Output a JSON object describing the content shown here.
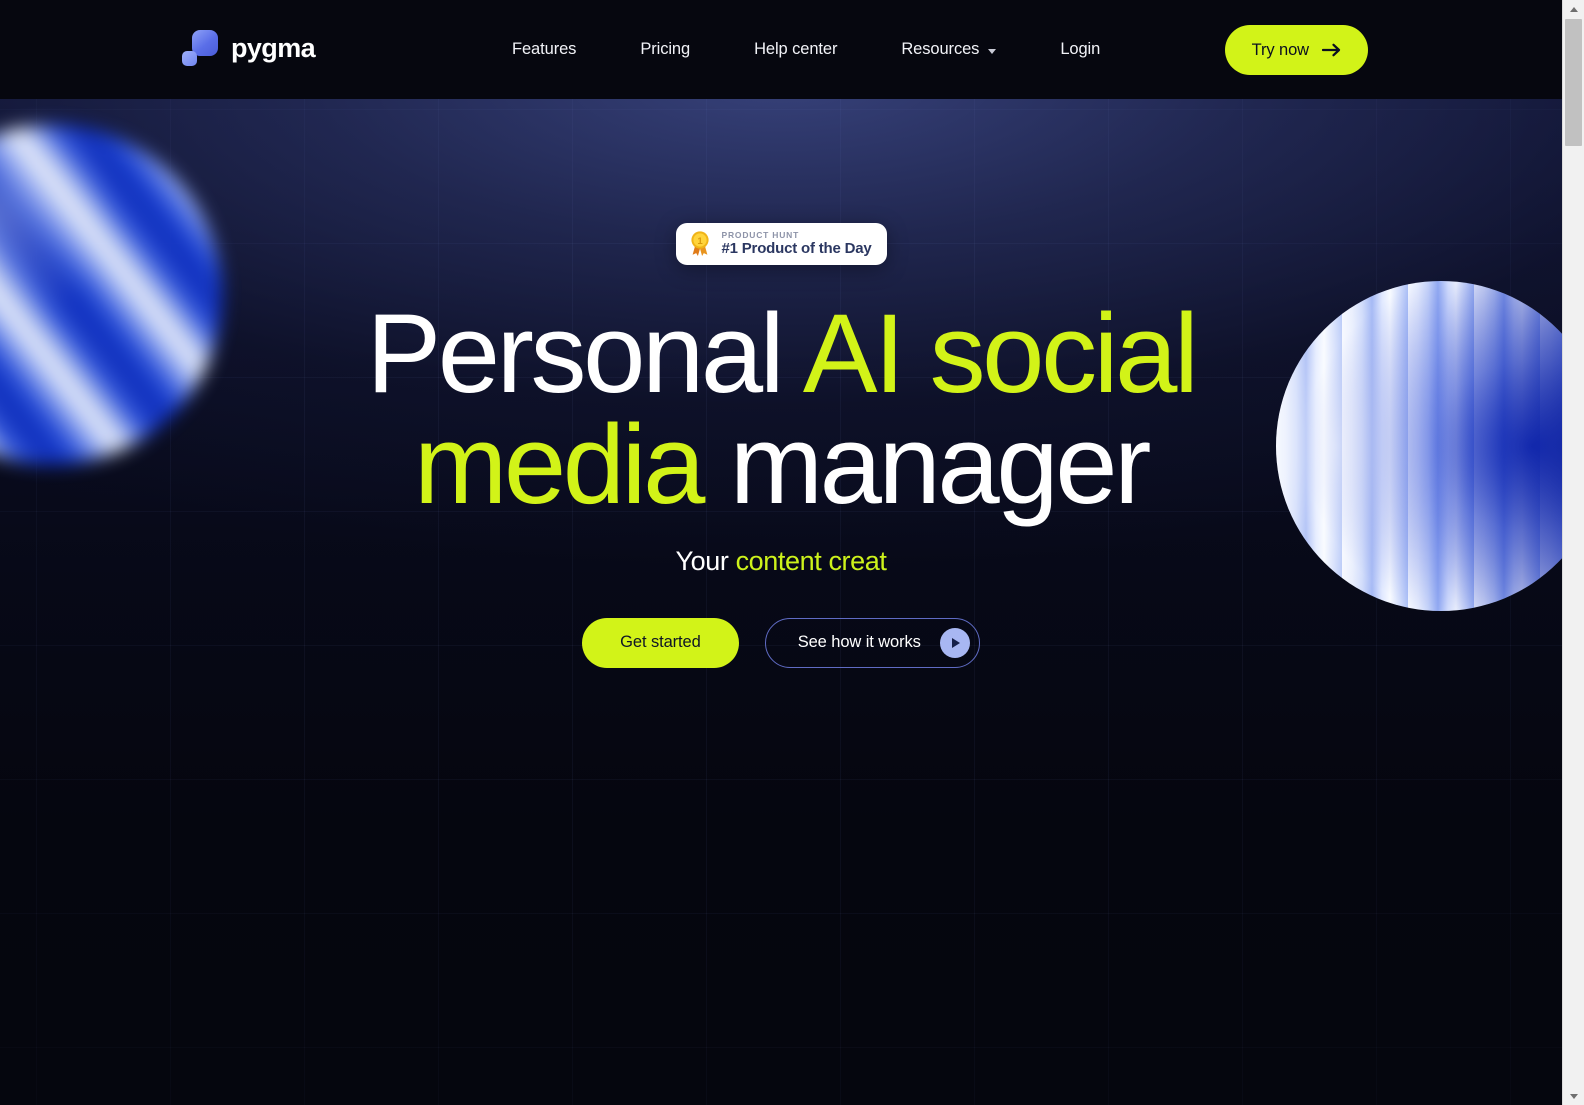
{
  "brand": {
    "name": "pygma",
    "logo_icon": "pygma-squares-logo",
    "accent_green": "#d2f318",
    "accent_blue": "#6f84f0",
    "header_bg": "#06070f",
    "hero_bg_top": "#39447e",
    "hero_bg_bottom": "#05060e"
  },
  "header": {
    "nav": [
      {
        "label": "Features",
        "has_dropdown": false
      },
      {
        "label": "Pricing",
        "has_dropdown": false
      },
      {
        "label": "Help center",
        "has_dropdown": false
      },
      {
        "label": "Resources",
        "has_dropdown": true
      },
      {
        "label": "Login",
        "has_dropdown": false
      }
    ],
    "cta": {
      "label": "Try now",
      "icon": "arrow-right-icon"
    }
  },
  "hero": {
    "badge": {
      "icon": "product-hunt-medal-icon",
      "kicker": "PRODUCT HUNT",
      "title": "#1 Product of the Day"
    },
    "headline": {
      "line1_white": "Personal ",
      "line1_green": "AI social",
      "line2_green": "media",
      "line2_white": " manager"
    },
    "subhead": {
      "static": "Your ",
      "typed": "content creat"
    },
    "buttons": {
      "primary": "Get started",
      "secondary": "See how it works",
      "secondary_icon": "play-circle-icon"
    },
    "decor": {
      "left_sphere": "blurred-swirl-sphere",
      "right_sphere": "ribbed-gradient-sphere"
    }
  },
  "scrollbar": {
    "up_icon": "scroll-up-arrow-icon",
    "down_icon": "scroll-down-arrow-icon",
    "thumb": "scroll-thumb"
  }
}
